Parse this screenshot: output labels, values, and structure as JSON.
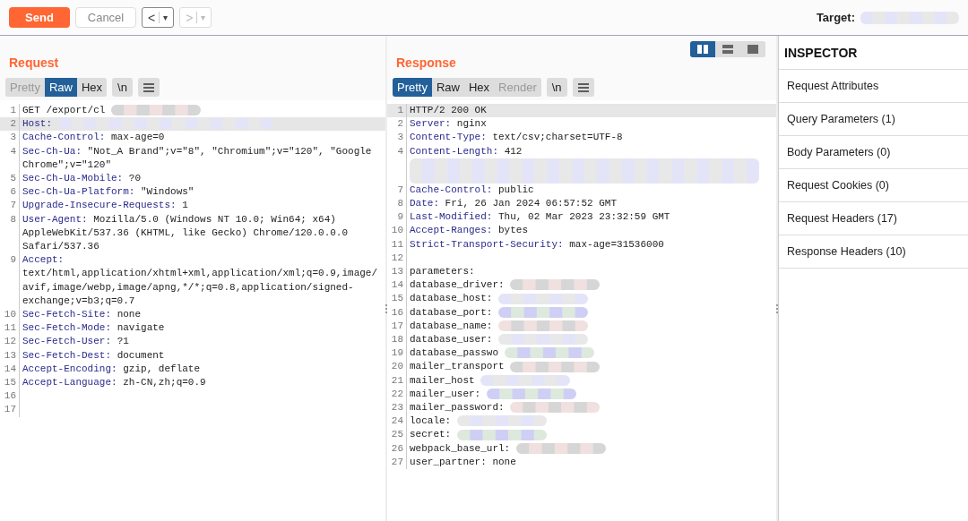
{
  "toolbar": {
    "send": "Send",
    "cancel": "Cancel",
    "back": {
      "label": "<",
      "caret": "▾",
      "disabled": false
    },
    "forward": {
      "label": ">",
      "caret": "▾",
      "disabled": true
    },
    "target_label": "Target:"
  },
  "request": {
    "title": "Request",
    "tabs": [
      {
        "label": "Pretty",
        "selected": false,
        "disabled": true
      },
      {
        "label": "Raw",
        "selected": true,
        "disabled": false
      },
      {
        "label": "Hex",
        "selected": false,
        "disabled": false
      }
    ],
    "newline_button": "\\n",
    "lines": [
      {
        "number": "1",
        "kind": "plain",
        "text": "GET /export/cl",
        "redacted": true,
        "highlighted": false
      },
      {
        "number": "2",
        "kind": "header",
        "key": "Host:",
        "redacted": true,
        "highlighted": true
      },
      {
        "number": "3",
        "kind": "header",
        "key": "Cache-Control:",
        "value": "max-age=0",
        "redacted": false,
        "highlighted": false
      },
      {
        "number": "4",
        "kind": "header",
        "key": "Sec-Ch-Ua:",
        "value": "\"Not_A Brand\";v=\"8\", \"Chromium\";v=\"120\", \"Google Chrome\";v=\"120\"",
        "redacted": false,
        "highlighted": false
      },
      {
        "number": "5",
        "kind": "header",
        "key": "Sec-Ch-Ua-Mobile:",
        "value": "?0",
        "redacted": false,
        "highlighted": false
      },
      {
        "number": "6",
        "kind": "header",
        "key": "Sec-Ch-Ua-Platform:",
        "value": "\"Windows\"",
        "redacted": false,
        "highlighted": false
      },
      {
        "number": "7",
        "kind": "header",
        "key": "Upgrade-Insecure-Requests:",
        "value": "1",
        "redacted": false,
        "highlighted": false
      },
      {
        "number": "8",
        "kind": "header",
        "key": "User-Agent:",
        "value": "Mozilla/5.0 (Windows NT 10.0; Win64; x64) AppleWebKit/537.36 (KHTML, like Gecko) Chrome/120.0.0.0 Safari/537.36",
        "redacted": false,
        "highlighted": false
      },
      {
        "number": "9",
        "kind": "header",
        "key": "Accept:",
        "value": "text/html,application/xhtml+xml,application/xml;q=0.9,image/avif,image/webp,image/apng,*/*;q=0.8,application/signed-exchange;v=b3;q=0.7",
        "redacted": false,
        "highlighted": false
      },
      {
        "number": "10",
        "kind": "header",
        "key": "Sec-Fetch-Site:",
        "value": "none",
        "redacted": false,
        "highlighted": false
      },
      {
        "number": "11",
        "kind": "header",
        "key": "Sec-Fetch-Mode:",
        "value": "navigate",
        "redacted": false,
        "highlighted": false
      },
      {
        "number": "12",
        "kind": "header",
        "key": "Sec-Fetch-User:",
        "value": "?1",
        "redacted": false,
        "highlighted": false
      },
      {
        "number": "13",
        "kind": "header",
        "key": "Sec-Fetch-Dest:",
        "value": "document",
        "redacted": false,
        "highlighted": false
      },
      {
        "number": "14",
        "kind": "header",
        "key": "Accept-Encoding:",
        "value": "gzip, deflate",
        "redacted": false,
        "highlighted": false
      },
      {
        "number": "15",
        "kind": "header",
        "key": "Accept-Language:",
        "value": "zh-CN,zh;q=0.9",
        "redacted": false,
        "highlighted": false
      },
      {
        "number": "16",
        "kind": "plain",
        "redacted": false,
        "highlighted": false
      },
      {
        "number": "17",
        "kind": "plain",
        "redacted": false,
        "highlighted": false
      }
    ]
  },
  "response": {
    "title": "Response",
    "layout_toggles": [
      {
        "selected": true
      },
      {
        "selected": false
      },
      {
        "selected": false
      }
    ],
    "tabs": [
      {
        "label": "Pretty",
        "selected": true,
        "disabled": false
      },
      {
        "label": "Raw",
        "selected": false,
        "disabled": false
      },
      {
        "label": "Hex",
        "selected": false,
        "disabled": false
      },
      {
        "label": "Render",
        "selected": false,
        "disabled": true
      }
    ],
    "newline_button": "\\n",
    "lines": [
      {
        "number": "1",
        "kind": "plain",
        "text": "HTTP/2 200 OK",
        "redacted": false,
        "highlighted": true
      },
      {
        "number": "2",
        "kind": "header",
        "key": "Server:",
        "value": "nginx",
        "redacted": false,
        "highlighted": false
      },
      {
        "number": "3",
        "kind": "header",
        "key": "Content-Type:",
        "value": "text/csv;charset=UTF-8",
        "redacted": false,
        "highlighted": false
      },
      {
        "number": "4",
        "kind": "header",
        "key": "Content-Length:",
        "value": "412",
        "redacted": false,
        "highlighted": false
      },
      {
        "kind": "plain",
        "redacted": true,
        "highlighted": false
      },
      {
        "number": "7",
        "kind": "header",
        "key": "Cache-Control:",
        "value": "public",
        "redacted": false,
        "highlighted": false
      },
      {
        "number": "8",
        "kind": "header",
        "key": "Date:",
        "value": "Fri, 26 Jan 2024 06:57:52 GMT",
        "redacted": false,
        "highlighted": false
      },
      {
        "number": "9",
        "kind": "header",
        "key": "Last-Modified:",
        "value": "Thu, 02 Mar 2023 23:32:59 GMT",
        "redacted": false,
        "highlighted": false
      },
      {
        "number": "10",
        "kind": "header",
        "key": "Accept-Ranges:",
        "value": "bytes",
        "redacted": false,
        "highlighted": false
      },
      {
        "number": "11",
        "kind": "header",
        "key": "Strict-Transport-Security:",
        "value": "max-age=31536000",
        "redacted": false,
        "highlighted": false
      },
      {
        "number": "12",
        "kind": "plain",
        "redacted": false,
        "highlighted": false
      },
      {
        "number": "13",
        "kind": "plain",
        "text": "parameters:",
        "redacted": false,
        "highlighted": false
      },
      {
        "number": "14",
        "kind": "plain",
        "text": "database_driver:",
        "redacted": true,
        "highlighted": false
      },
      {
        "number": "15",
        "kind": "plain",
        "text": "database_host:",
        "redacted": true,
        "highlighted": false
      },
      {
        "number": "16",
        "kind": "plain",
        "text": "database_port:",
        "redacted": true,
        "highlighted": false
      },
      {
        "number": "17",
        "kind": "plain",
        "text": "database_name:",
        "redacted": true,
        "highlighted": false
      },
      {
        "number": "18",
        "kind": "plain",
        "text": "database_user:",
        "redacted": true,
        "highlighted": false
      },
      {
        "number": "19",
        "kind": "plain",
        "text": "database_passwo",
        "redacted": true,
        "highlighted": false
      },
      {
        "number": "20",
        "kind": "plain",
        "text": "mailer_transport",
        "redacted": true,
        "highlighted": false
      },
      {
        "number": "21",
        "kind": "plain",
        "text": "mailer_host",
        "redacted": true,
        "highlighted": false
      },
      {
        "number": "22",
        "kind": "plain",
        "text": "mailer_user:",
        "redacted": true,
        "highlighted": false
      },
      {
        "number": "23",
        "kind": "plain",
        "text": "mailer_password:",
        "redacted": true,
        "highlighted": false
      },
      {
        "number": "24",
        "kind": "plain",
        "text": "locale:",
        "redacted": true,
        "highlighted": false
      },
      {
        "number": "25",
        "kind": "plain",
        "text": "secret:",
        "redacted": true,
        "highlighted": false
      },
      {
        "number": "26",
        "kind": "plain",
        "text": "webpack_base_url:",
        "redacted": true,
        "highlighted": false
      },
      {
        "number": "27",
        "kind": "plain",
        "text": "user_partner: none",
        "redacted": false,
        "highlighted": false
      }
    ]
  },
  "inspector": {
    "title": "INSPECTOR",
    "items": [
      "Request Attributes",
      "Query Parameters (1)",
      "Body Parameters (0)",
      "Request Cookies (0)",
      "Request Headers (17)",
      "Response Headers (10)"
    ]
  }
}
